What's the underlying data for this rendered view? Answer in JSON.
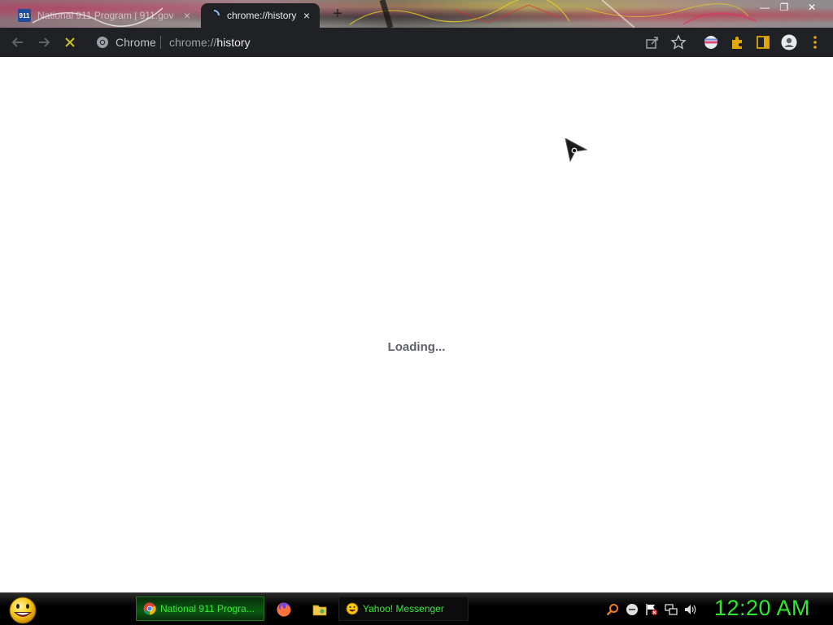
{
  "browser": {
    "tabs": [
      {
        "title": "National 911 Program | 911.gov",
        "favicon_text": "911",
        "active": false
      },
      {
        "title": "chrome://history",
        "active": true
      }
    ],
    "window_controls": {
      "minimize": "—",
      "restore": "❐",
      "close": "✕"
    },
    "new_tab_label": "+",
    "omnibox": {
      "scheme_label": "Chrome",
      "url_prefix": "chrome://",
      "url_host": "history"
    }
  },
  "content": {
    "loading_text": "Loading..."
  },
  "taskbar": {
    "tasks": [
      {
        "label": "National 911 Progra...",
        "icon": "chrome-icon"
      },
      {
        "label": "Yahoo! Messenger",
        "icon": "yahoo-messenger-icon"
      }
    ],
    "quick_launch": [
      "firefox-icon",
      "folder-icon"
    ],
    "tray": [
      "search-icon",
      "messenger-status-icon",
      "action-center-flag-icon",
      "network-icon",
      "volume-icon"
    ],
    "clock": "12:20 AM"
  },
  "colors": {
    "toolbar_bg": "#202124",
    "clock_green": "#2eea2e",
    "task_text_green": "#39e639"
  }
}
